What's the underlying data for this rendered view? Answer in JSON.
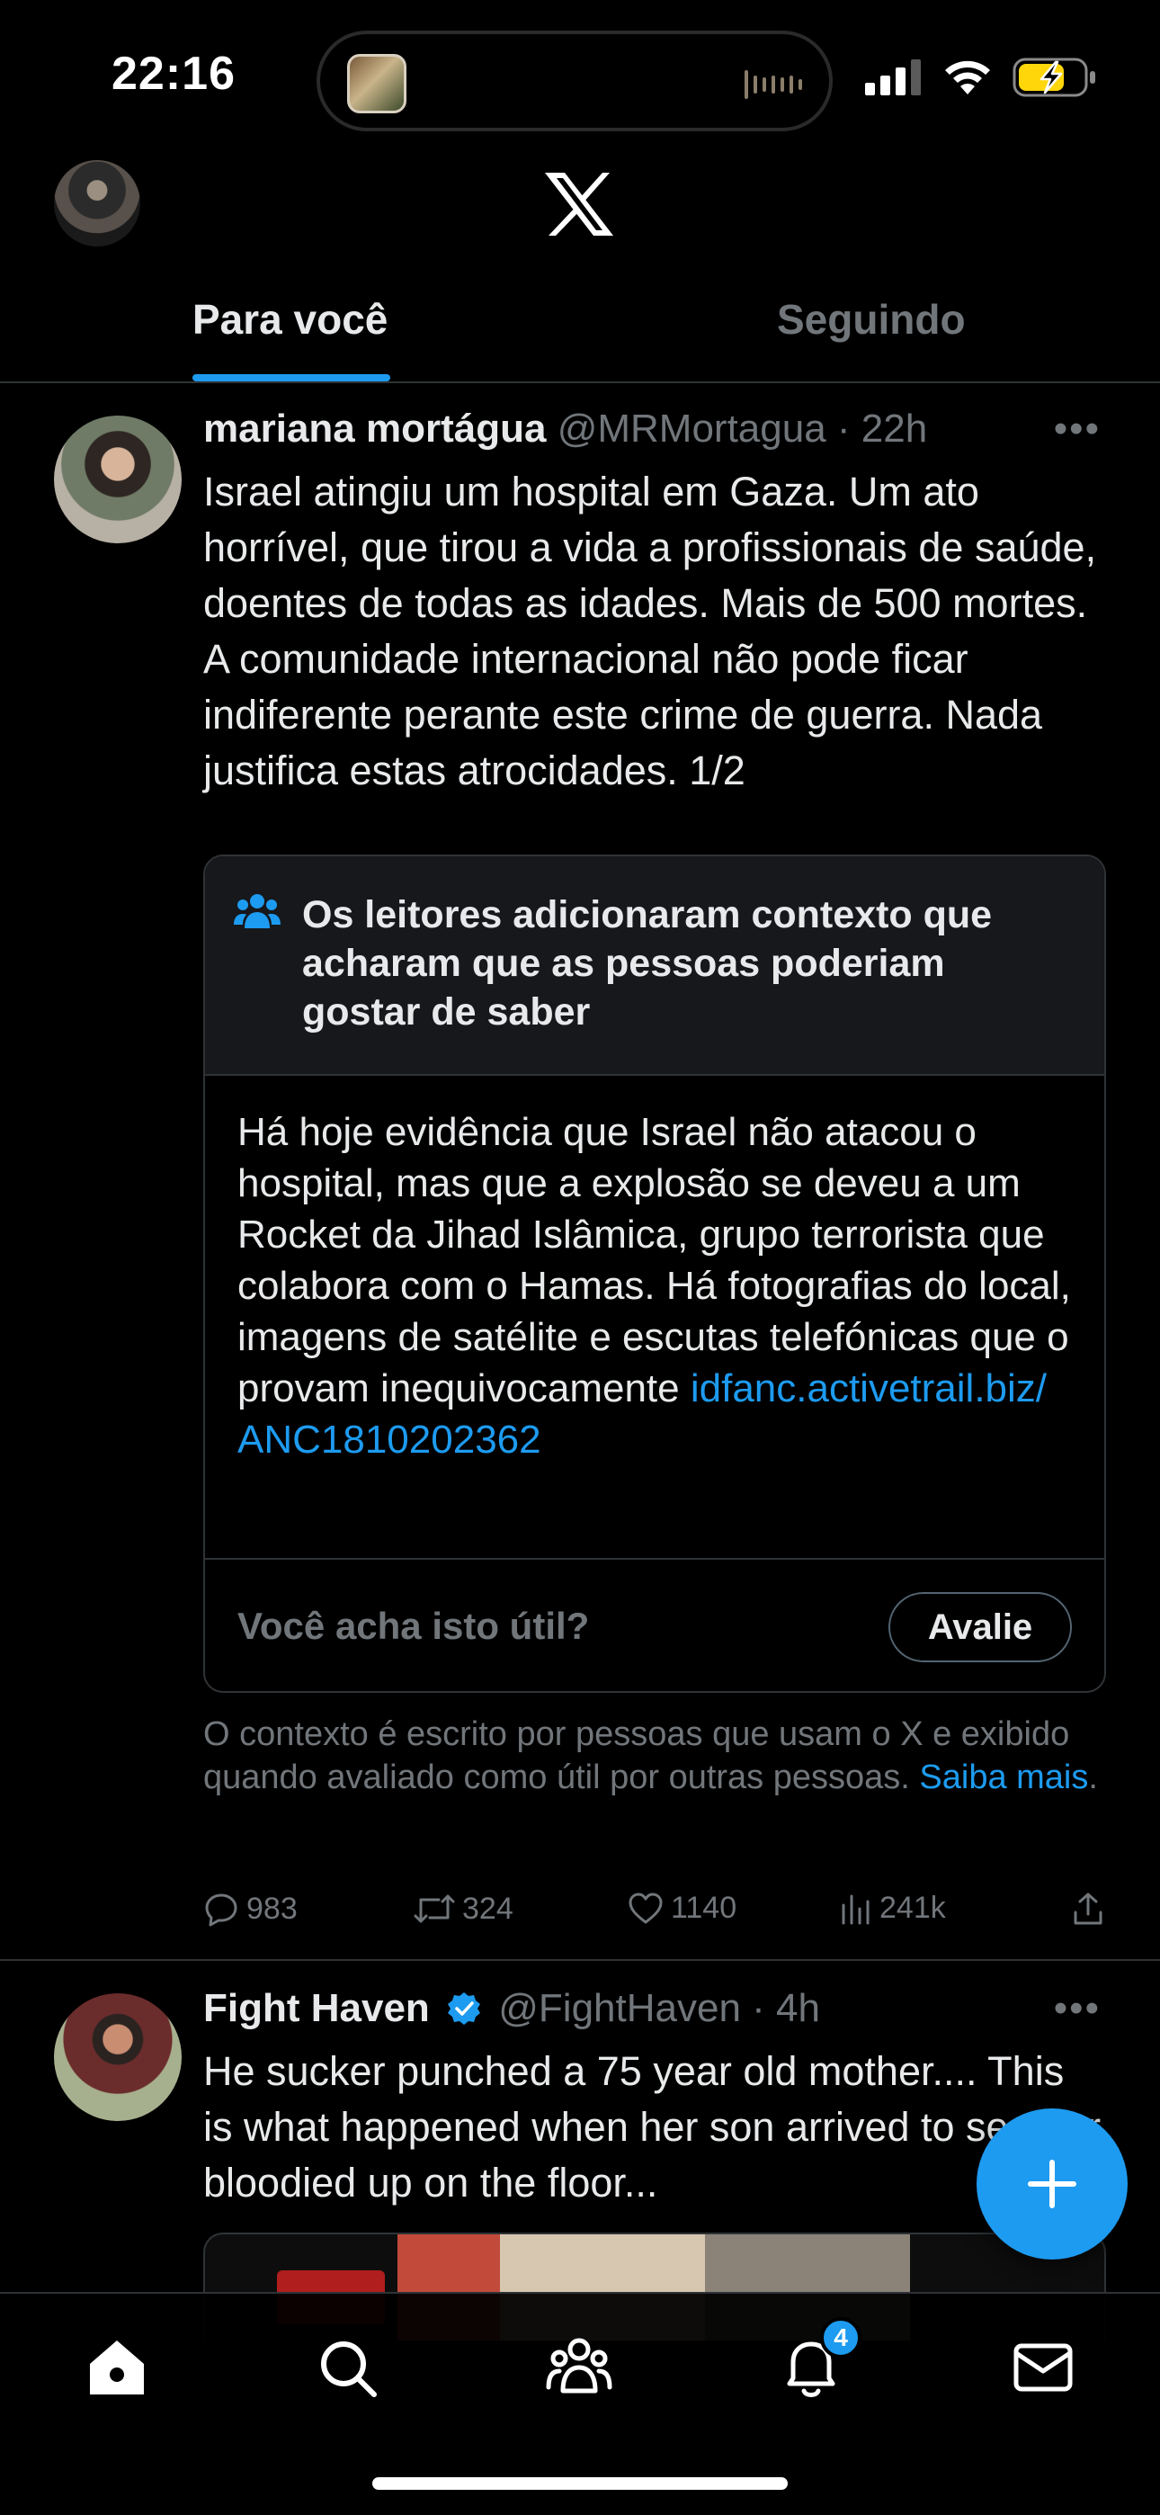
{
  "status_bar": {
    "time": "22:16"
  },
  "tabs": [
    {
      "label": "Para você",
      "active": true
    },
    {
      "label": "Seguindo",
      "active": false
    }
  ],
  "tweets": [
    {
      "name": "mariana mortágua",
      "handle": "@MRMortagua",
      "time": "· 22h",
      "text": "Israel atingiu um hospital em Gaza. Um ato horrível, que tirou a vida a profissionais de saúde, doentes de todas as idades. Mais de 500 mortes. A comunidade internacional não pode ficar indiferente perante este crime de guerra. Nada justifica estas atrocidades. 1/2",
      "note": {
        "title": "Os leitores adicionaram contexto que acharam que as pessoas poderiam gostar de saber",
        "body": "Há hoje evidência que Israel não atacou o hospital, mas que a explosão se deveu a um Rocket da Jihad Islâmica, grupo terrorista que colabora com o Hamas. Há fotografias do local, imagens de satélite e escutas telefónicas que o provam inequivocamente ",
        "link": "idfanc.activetrail.biz/ ANC1810202362",
        "question": "Você acha isto útil?",
        "rate_label": "Avalie",
        "footer": "O contexto é escrito por pessoas que usam o X e exibido quando avaliado como útil por outras pessoas. ",
        "learn_more": "Saiba mais",
        "footer_end": "."
      },
      "stats": {
        "replies": "983",
        "retweets": "324",
        "likes": "1140",
        "views": "241k"
      }
    },
    {
      "name": "Fight Haven",
      "handle": "@FightHaven",
      "time": "· 4h",
      "verified": true,
      "text": "He sucker punched a 75 year old mother.... This is what happened when her son arrived to see her bloodied up on the floor..."
    }
  ],
  "bottom_nav": {
    "items": [
      "home-icon",
      "search-icon",
      "communities-icon",
      "notifications-icon",
      "messages-icon"
    ],
    "notifications_badge": "4"
  },
  "colors": {
    "accent": "#1d9bf0",
    "background": "#000000",
    "muted": "#71767b",
    "text": "#e7e9ea"
  }
}
